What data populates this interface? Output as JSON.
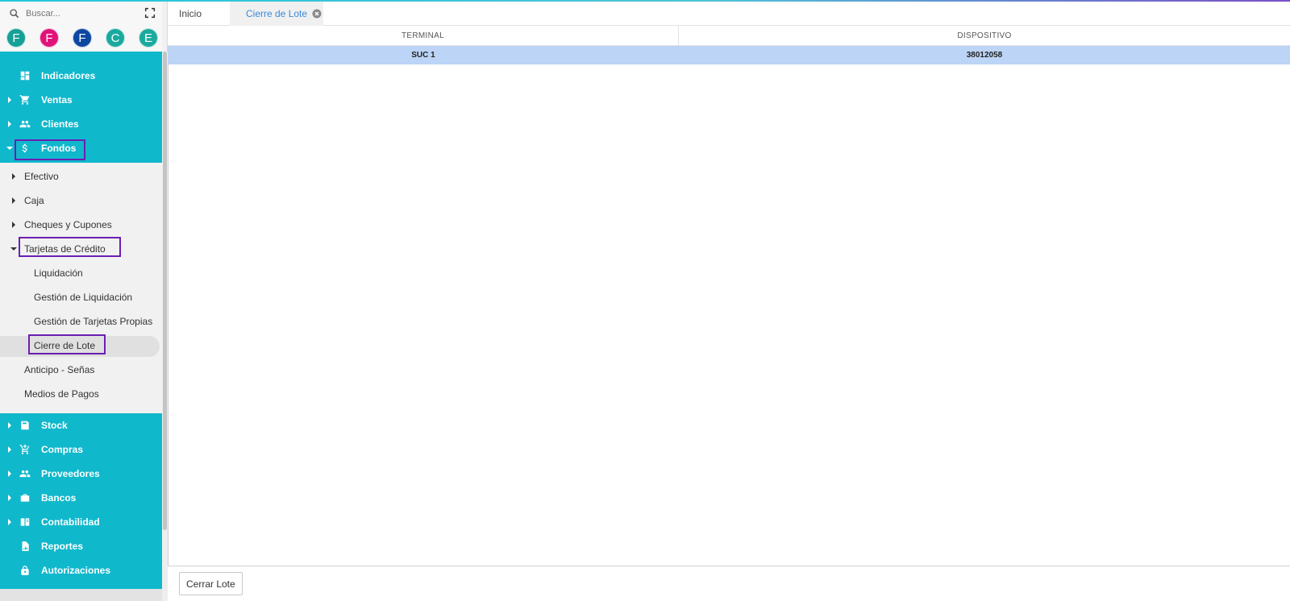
{
  "search": {
    "placeholder": "Buscar..."
  },
  "avatars": [
    {
      "letter": "F",
      "color": "#16a096"
    },
    {
      "letter": "F",
      "color": "#e0137a"
    },
    {
      "letter": "F",
      "color": "#0d47a1"
    },
    {
      "letter": "C",
      "color": "#1ba99e"
    },
    {
      "letter": "E",
      "color": "#1ba99e"
    }
  ],
  "menu": {
    "indicadores": "Indicadores",
    "ventas": "Ventas",
    "clientes": "Clientes",
    "fondos": "Fondos",
    "stock": "Stock",
    "compras": "Compras",
    "proveedores": "Proveedores",
    "bancos": "Bancos",
    "contabilidad": "Contabilidad",
    "reportes": "Reportes",
    "autorizaciones": "Autorizaciones"
  },
  "fondos_sub": {
    "efectivo": "Efectivo",
    "caja": "Caja",
    "cheques": "Cheques y Cupones",
    "tarjetas": "Tarjetas de Crédito",
    "liquidacion": "Liquidación",
    "gestion_liquidacion": "Gestión de Liquidación",
    "gestion_tarjetas": "Gestión de Tarjetas Propias",
    "cierre_lote": "Cierre de Lote",
    "anticipo": "Anticipo - Señas",
    "medios": "Medios de Pagos"
  },
  "tabs": {
    "inicio": "Inicio",
    "cierre": "Cierre de Lote"
  },
  "table": {
    "headers": [
      "TERMINAL",
      "DISPOSITIVO"
    ],
    "rows": [
      [
        "SUC 1",
        "38012058"
      ]
    ]
  },
  "footer": {
    "button": "Cerrar Lote"
  },
  "colors": {
    "sidebar_teal": "#10b8cc",
    "highlight_box": "#6a1fb3",
    "selected_row": "#bcd4f6",
    "active_tab_text": "#3b8ad9"
  }
}
